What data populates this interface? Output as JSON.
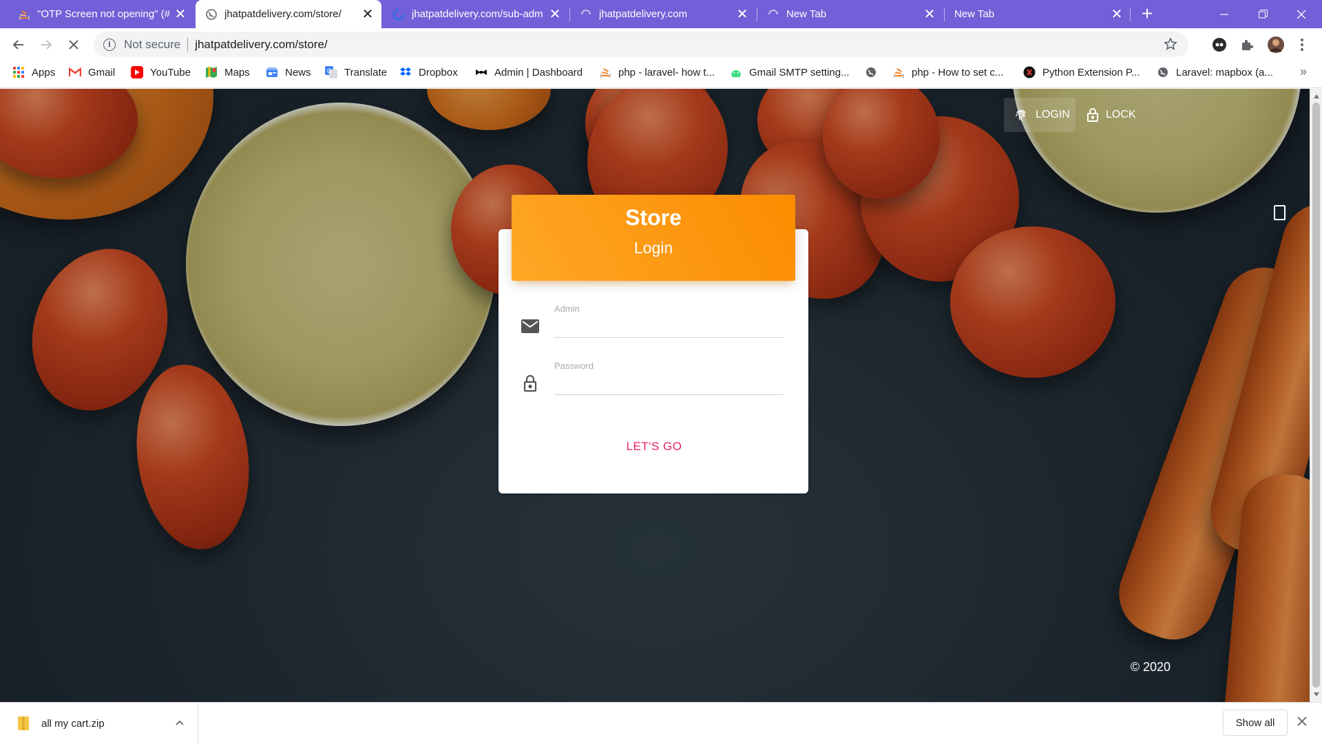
{
  "browser": {
    "tabs": [
      {
        "title": "\"OTP Screen not opening\" (#",
        "icon": "stackoverflow-icon",
        "active": false
      },
      {
        "title": "jhatpatdelivery.com/store/",
        "icon": "globe-icon",
        "active": true
      },
      {
        "title": "jhatpatdelivery.com/sub-adm",
        "icon": "loading-spinner-icon",
        "active": false
      },
      {
        "title": "jhatpatdelivery.com",
        "icon": "loading-spinner-icon",
        "active": false
      },
      {
        "title": "New Tab",
        "icon": "loading-spinner-icon",
        "active": false
      },
      {
        "title": "New Tab",
        "icon": "none",
        "active": false
      }
    ],
    "tab_close_glyph": "✕",
    "new_tab_glyph": "+",
    "address": {
      "security_label": "Not secure",
      "url": "jhatpatdelivery.com/store/"
    },
    "bookmarks": [
      {
        "label": "Apps",
        "icon": "apps-grid-icon"
      },
      {
        "label": "Gmail",
        "icon": "gmail-icon"
      },
      {
        "label": "YouTube",
        "icon": "youtube-icon"
      },
      {
        "label": "Maps",
        "icon": "maps-icon"
      },
      {
        "label": "News",
        "icon": "news-icon"
      },
      {
        "label": "Translate",
        "icon": "translate-icon"
      },
      {
        "label": "Dropbox",
        "icon": "dropbox-icon"
      },
      {
        "label": "Admin | Dashboard",
        "icon": "bowtie-icon"
      },
      {
        "label": "php - laravel- how t...",
        "icon": "stackoverflow-icon"
      },
      {
        "label": "Gmail SMTP setting...",
        "icon": "android-icon"
      },
      {
        "label": "",
        "icon": "globe-icon"
      },
      {
        "label": "php - How to set c...",
        "icon": "stackoverflow-icon"
      },
      {
        "label": "Python Extension P...",
        "icon": "python-ext-icon"
      },
      {
        "label": "Laravel: mapbox (a...",
        "icon": "globe-icon"
      }
    ],
    "bookmarks_overflow": "»"
  },
  "page": {
    "nav": {
      "login_label": "LOGIN",
      "lock_label": "LOCK"
    },
    "card": {
      "title": "Store",
      "subtitle": "Login",
      "admin_label": "Admin",
      "admin_value": "",
      "password_label": "Password",
      "password_value": "",
      "submit_label": "LET'S GO"
    },
    "copyright": "© 2020",
    "colors": {
      "header_orange": "#fb8c00",
      "submit_pink": "#e91e63",
      "tabstrip_purple": "#7160d7"
    }
  },
  "downloads": {
    "file_name": "all my cart.zip",
    "show_all_label": "Show all"
  }
}
